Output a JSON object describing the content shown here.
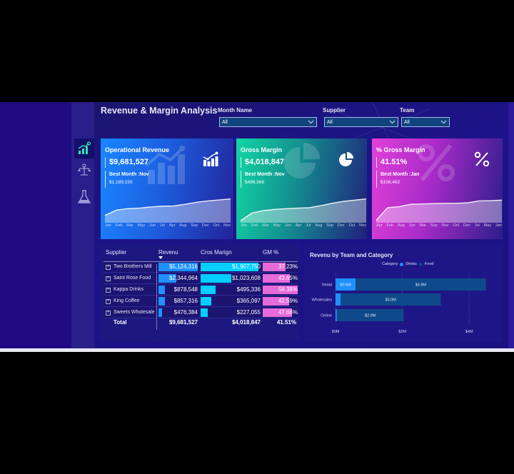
{
  "header": {
    "title": "Revenue & Margin Analysis"
  },
  "filters": [
    {
      "label": "Month Name",
      "value": "All"
    },
    {
      "label": "Supplier",
      "value": "All"
    },
    {
      "label": "Team",
      "value": "All"
    }
  ],
  "nav": [
    {
      "icon": "growth-chart-icon",
      "active": true
    },
    {
      "icon": "scales-icon",
      "active": false
    },
    {
      "icon": "flask-icon",
      "active": false
    }
  ],
  "colors": {
    "revenue_bar": "#1e90ff",
    "margin_bar": "#00cfff",
    "gm_pct_bar": "#e66ad8",
    "drinks": "#1e90ff",
    "food": "#0e4a8a"
  },
  "cards": [
    {
      "title": "Operational Revenue",
      "value": "$9,681,527",
      "best_month_label": "Best Month :Nov",
      "best_month_value": "$1,189,150",
      "icon": "bar-chart-trend-icon",
      "months": [
        "Jan",
        "Feb",
        "Mar",
        "May",
        "Jun",
        "Jul",
        "Apr",
        "Aug",
        "Sep",
        "Dec",
        "Oct",
        "Nov"
      ],
      "trend": [
        0.3,
        0.52,
        0.58,
        0.6,
        0.65,
        0.68,
        0.69,
        0.76,
        0.84,
        0.9,
        0.94,
        0.98
      ]
    },
    {
      "title": "Gross Margin",
      "value": "$4,018,847",
      "best_month_label": "Best Month :Nov",
      "best_month_value": "$496,568",
      "icon": "pie-chart-icon",
      "months": [
        "Jan",
        "Feb",
        "Mar",
        "May",
        "Jun",
        "Apr",
        "Jul",
        "Aug",
        "Sep",
        "Dec",
        "Oct",
        "Nov"
      ],
      "trend": [
        0.08,
        0.4,
        0.5,
        0.55,
        0.58,
        0.6,
        0.62,
        0.7,
        0.8,
        0.88,
        0.93,
        0.98
      ]
    },
    {
      "title": "% Gross Margin",
      "value": "41.51%",
      "best_month_label": "Best Month :Jan",
      "best_month_value": "$108,462",
      "icon": "percent-icon",
      "months": [
        "Apr",
        "Feb",
        "Aug",
        "Jun",
        "Mar",
        "Sep",
        "Nov",
        "Oct",
        "Dec",
        "Jul",
        "May",
        "Jan"
      ],
      "trend": [
        0.1,
        0.62,
        0.66,
        0.76,
        0.77,
        0.79,
        0.8,
        0.8,
        0.82,
        0.9,
        0.91,
        0.93
      ]
    }
  ],
  "table": {
    "headers": [
      "Supplier",
      "Revenu",
      "Cros Marign",
      "GM %"
    ],
    "rows": [
      {
        "supplier": "Two Brothers Mill",
        "revenue": "$5,124,316",
        "revenue_num": 5124316,
        "margin": "$1,907,750",
        "margin_num": 1907750,
        "gm_pct": "37.23%",
        "gm_num": 37.23
      },
      {
        "supplier": "Saint Rose Food",
        "revenue": "$2,344,964",
        "revenue_num": 2344964,
        "margin": "$1,023,608",
        "margin_num": 1023608,
        "gm_pct": "43.65%",
        "gm_num": 43.65
      },
      {
        "supplier": "Kappa Drinks",
        "revenue": "$878,548",
        "revenue_num": 878548,
        "margin": "$495,336",
        "margin_num": 495336,
        "gm_pct": "56.38%",
        "gm_num": 56.38
      },
      {
        "supplier": "King Coffee",
        "revenue": "$857,316",
        "revenue_num": 857316,
        "margin": "$365,097",
        "margin_num": 365097,
        "gm_pct": "42.59%",
        "gm_num": 42.59
      },
      {
        "supplier": "Sweets Wholesale",
        "revenue": "$476,384",
        "revenue_num": 476384,
        "margin": "$227,055",
        "margin_num": 227055,
        "gm_pct": "47.66%",
        "gm_num": 47.66
      }
    ],
    "total": {
      "label": "Total",
      "revenue": "$9,681,527",
      "margin": "$4,018,847",
      "gm_pct": "41.51%"
    }
  },
  "chart_data": {
    "type": "bar",
    "orientation": "horizontal-stacked",
    "title": "Revenu by Team and Category",
    "legend_title": "Category",
    "legend_position": "top-center",
    "categories": [
      "Retail",
      "Wholesales",
      "Online"
    ],
    "series": [
      {
        "name": "Drinks",
        "values": [
          0.6,
          0.15,
          0.04
        ],
        "labels": [
          "$0.6M",
          "",
          ""
        ]
      },
      {
        "name": "Food",
        "values": [
          3.9,
          3.0,
          2.0
        ],
        "labels": [
          "$3.9M",
          "$3.0M",
          "$2.0M"
        ]
      }
    ],
    "xlabel": "",
    "ylabel": "",
    "xticks": [
      "$0M",
      "$2M",
      "$4M"
    ],
    "xtick_values": [
      0,
      2,
      4
    ],
    "xlim": [
      0,
      4.7
    ],
    "grid": "vertical-dotted"
  }
}
